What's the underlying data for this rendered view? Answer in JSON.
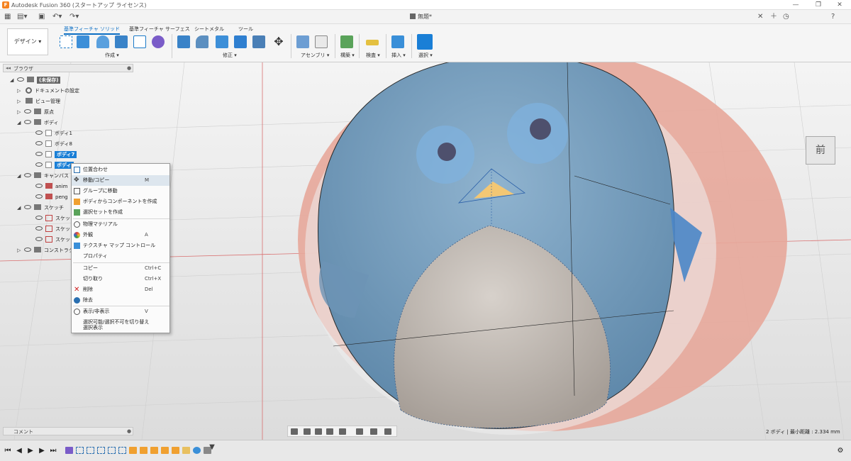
{
  "window": {
    "title": "Autodesk Fusion 360 (スタートアップ ライセンス)",
    "doc_title": "無題*"
  },
  "ribbon": {
    "workspace": "デザイン ▾",
    "tabs": [
      "基準フィーチャ ソリッド",
      "基準フィーチャ サーフェス",
      "シートメタル",
      "ツール"
    ],
    "groups": [
      "作成 ▾",
      "修正 ▾",
      "アセンブリ ▾",
      "構築 ▾",
      "検査 ▾",
      "挿入 ▾",
      "選択 ▾"
    ]
  },
  "browser": {
    "title": "ブラウザ",
    "root": "(未保存)",
    "items": [
      {
        "label": "ドキュメントの設定"
      },
      {
        "label": "ビュー管理"
      },
      {
        "label": "原点"
      },
      {
        "label": "ボディ"
      },
      {
        "label": "ボディ1"
      },
      {
        "label": "ボディ8"
      },
      {
        "label": "ボディ7"
      },
      {
        "label": "ボディ"
      },
      {
        "label": "キャンバス"
      },
      {
        "label": "anim"
      },
      {
        "label": "peng"
      },
      {
        "label": "スケッチ"
      },
      {
        "label": "スケッ"
      },
      {
        "label": "スケッ"
      },
      {
        "label": "スケッ"
      },
      {
        "label": "コンストラク"
      }
    ]
  },
  "context_menu": {
    "items": [
      {
        "label": "位置合わせ",
        "shortcut": ""
      },
      {
        "label": "移動/コピー",
        "shortcut": "M"
      },
      {
        "label": "グループに移動",
        "shortcut": ""
      },
      {
        "label": "ボディからコンポーネントを作成",
        "shortcut": ""
      },
      {
        "label": "選択セットを作成",
        "shortcut": ""
      },
      {
        "label": "物理マテリアル",
        "shortcut": ""
      },
      {
        "label": "外観",
        "shortcut": "A"
      },
      {
        "label": "テクスチャ マップ コントロール",
        "shortcut": ""
      },
      {
        "label": "プロパティ",
        "shortcut": ""
      },
      {
        "label": "コピー",
        "shortcut": "Ctrl+C"
      },
      {
        "label": "切り取り",
        "shortcut": "Ctrl+X"
      },
      {
        "label": "削除",
        "shortcut": "Del"
      },
      {
        "label": "除去",
        "shortcut": ""
      },
      {
        "label": "表示/非表示",
        "shortcut": "V"
      },
      {
        "label": "選択可能/選択不可を切り替え",
        "shortcut": ""
      },
      {
        "label": "選択表示",
        "shortcut": ""
      }
    ]
  },
  "comments": {
    "title": "コメント"
  },
  "status": {
    "selection_info": "2 ボディ | 最小距離 : 2.334 mm"
  },
  "viewcube": {
    "face_label": "前",
    "axis": "Z"
  },
  "colors": {
    "accent": "#0b6ec4",
    "selection": "#1a7fd6",
    "canvas_pink": "#e7a79a",
    "body_blue": "#7aa3c4",
    "belly": "#c9c0b8",
    "beak": "#f3c774"
  }
}
